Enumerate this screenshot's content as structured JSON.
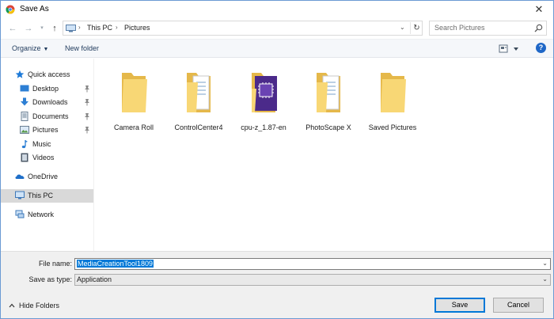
{
  "window": {
    "title": "Save As"
  },
  "address": {
    "crumbs": [
      "This PC",
      "Pictures"
    ]
  },
  "search": {
    "placeholder": "Search Pictures"
  },
  "toolbar": {
    "organize": "Organize",
    "new_folder": "New folder",
    "help": "?"
  },
  "nav": {
    "quick_access": "Quick access",
    "items": [
      {
        "label": "Desktop",
        "icon": "desktop-icon",
        "pinned": true
      },
      {
        "label": "Downloads",
        "icon": "downloads-icon",
        "pinned": true
      },
      {
        "label": "Documents",
        "icon": "documents-icon",
        "pinned": true
      },
      {
        "label": "Pictures",
        "icon": "pictures-icon",
        "pinned": true
      },
      {
        "label": "Music",
        "icon": "music-icon",
        "pinned": false
      },
      {
        "label": "Videos",
        "icon": "videos-icon",
        "pinned": false
      }
    ],
    "onedrive": "OneDrive",
    "this_pc": "This PC",
    "network": "Network"
  },
  "files": [
    {
      "name": "Camera Roll",
      "type": "folder-empty"
    },
    {
      "name": "ControlCenter4",
      "type": "folder-docs"
    },
    {
      "name": "cpu-z_1.87-en",
      "type": "cpu-z-folder"
    },
    {
      "name": "PhotoScape X",
      "type": "folder-docs"
    },
    {
      "name": "Saved Pictures",
      "type": "folder-empty"
    }
  ],
  "form": {
    "file_name_label": "File name:",
    "file_name_value": "MediaCreationTool1809",
    "save_as_type_label": "Save as type:",
    "save_as_type_value": "Application"
  },
  "footer": {
    "hide_folders": "Hide Folders",
    "save": "Save",
    "cancel": "Cancel"
  },
  "colors": {
    "accent": "#0078d7",
    "folder": "#f8d775",
    "selected_nav": "#d9d9d9"
  }
}
